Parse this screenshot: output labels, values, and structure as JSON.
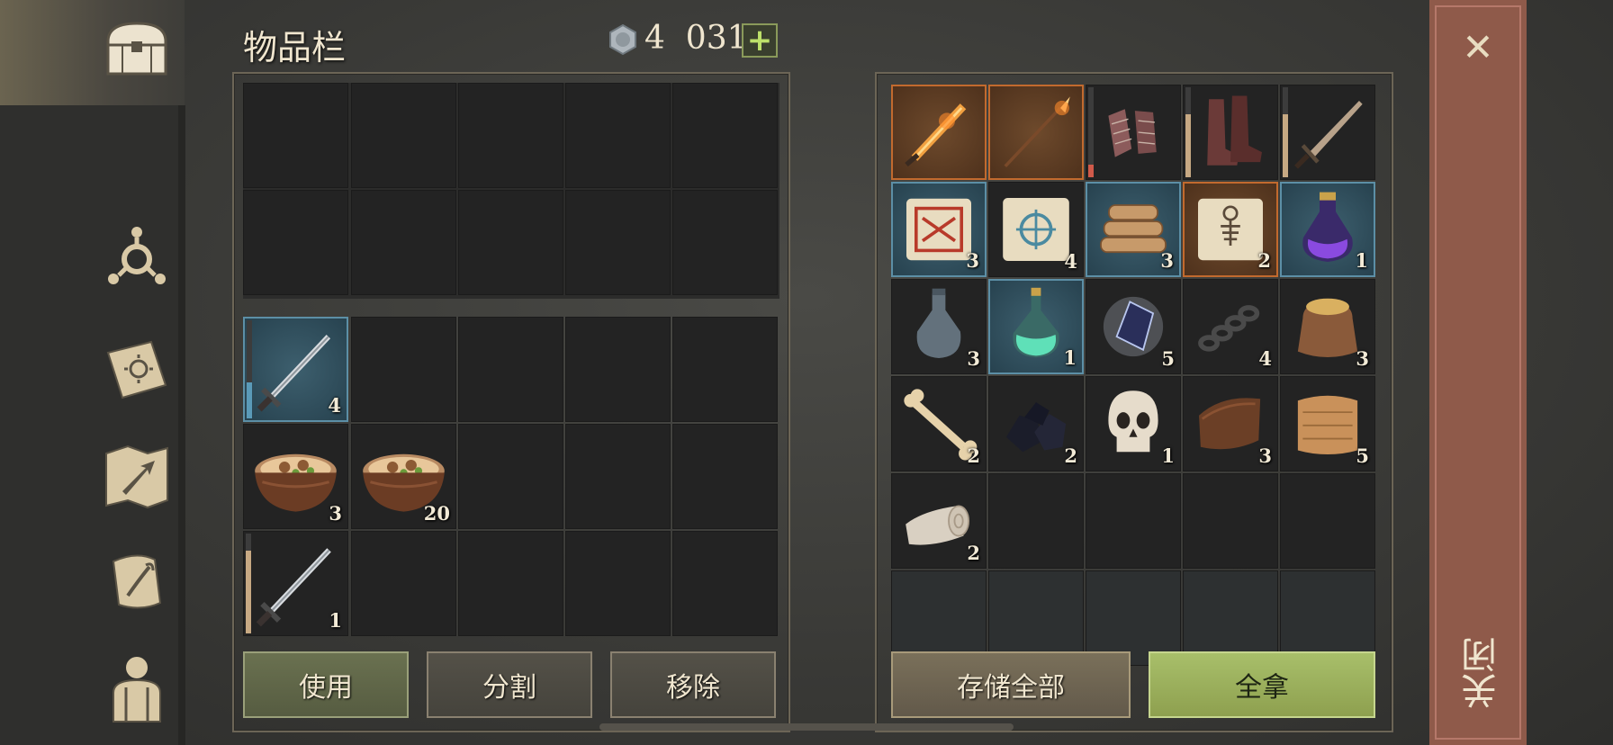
{
  "header": {
    "title": "物品栏",
    "currency_amount": "4  031",
    "add_label": "+"
  },
  "inventory": {
    "sword_1_count": "4",
    "stew_1_count": "3",
    "stew_2_count": "20",
    "sword_2_count": "1"
  },
  "container": {
    "items": [
      {
        "name": "flame-sword",
        "count": ""
      },
      {
        "name": "flame-spear",
        "count": ""
      },
      {
        "name": "chainmail-gloves",
        "count": ""
      },
      {
        "name": "leather-boots",
        "count": ""
      },
      {
        "name": "short-sword",
        "count": ""
      },
      {
        "name": "red-scroll",
        "count": "3"
      },
      {
        "name": "blue-scroll",
        "count": "4"
      },
      {
        "name": "firewood",
        "count": "3"
      },
      {
        "name": "skeleton-scroll",
        "count": "2"
      },
      {
        "name": "purple-potion",
        "count": "1"
      },
      {
        "name": "empty-bottle",
        "count": "3"
      },
      {
        "name": "green-potion",
        "count": "1"
      },
      {
        "name": "dark-crystal",
        "count": "5"
      },
      {
        "name": "iron-chain",
        "count": "4"
      },
      {
        "name": "grain-sack",
        "count": "3"
      },
      {
        "name": "bone",
        "count": "2"
      },
      {
        "name": "coal",
        "count": "2"
      },
      {
        "name": "skull",
        "count": "1"
      },
      {
        "name": "leather",
        "count": "3"
      },
      {
        "name": "cloth",
        "count": "5"
      },
      {
        "name": "linen-roll",
        "count": "2"
      }
    ]
  },
  "buttons": {
    "use": "使用",
    "split": "分割",
    "remove": "移除",
    "store_all": "存储全部",
    "take_all": "全拿"
  },
  "close": {
    "label": "关闭",
    "x": "✕"
  },
  "colors": {
    "rare_border": "#5c8fa6",
    "epic_border": "#c26a2e",
    "take_button": "#a8bf6a"
  }
}
